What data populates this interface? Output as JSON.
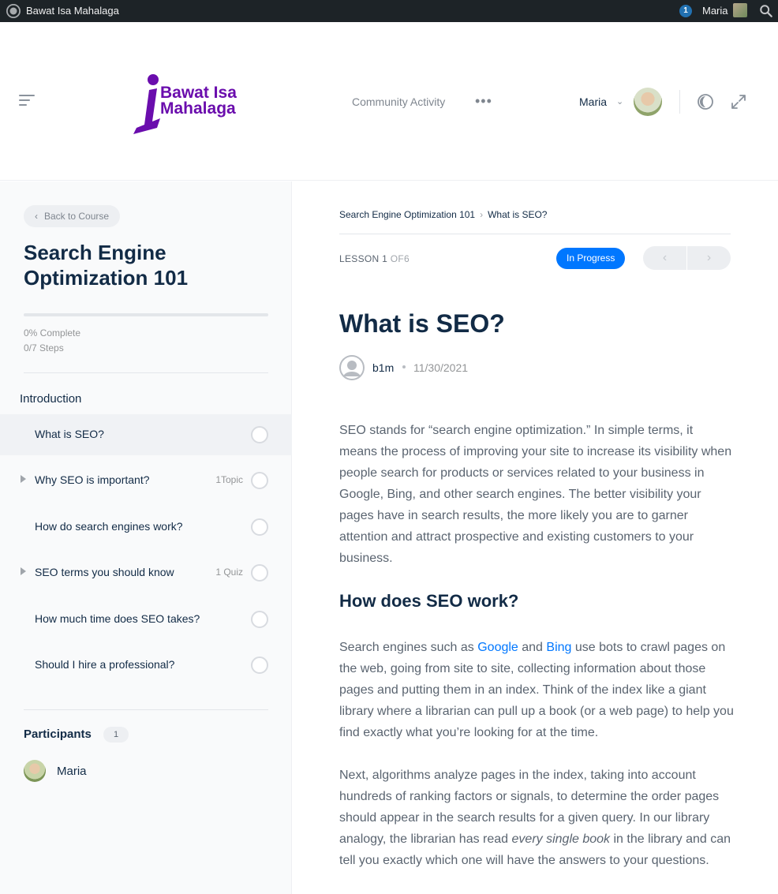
{
  "admin_bar": {
    "site_name": "Bawat Isa Mahalaga",
    "notification_count": "1",
    "user": "Maria"
  },
  "header": {
    "logo_line1": "Bawat Isa",
    "logo_line2": "Mahalaga",
    "nav_community": "Community Activity",
    "nav_more": "•••",
    "user_name": "Maria",
    "user_chevron": "⌄"
  },
  "sidebar": {
    "back_label": "Back to Course",
    "course_title": "Search Engine Optimization 101",
    "progress_fraction": 0,
    "percent_complete": "0% Complete",
    "steps": "0/7 Steps",
    "section": "Introduction",
    "lessons": [
      {
        "label": "What is SEO?",
        "meta": "",
        "expandable": false,
        "active": true
      },
      {
        "label": "Why SEO is important?",
        "meta": "1Topic",
        "expandable": true,
        "active": false
      },
      {
        "label": "How do search engines work?",
        "meta": "",
        "expandable": false,
        "active": false
      },
      {
        "label": "SEO terms you should know",
        "meta": "1 Quiz",
        "expandable": true,
        "active": false
      },
      {
        "label": "How much time does SEO takes?",
        "meta": "",
        "expandable": false,
        "active": false
      },
      {
        "label": "Should I hire a professional?",
        "meta": "",
        "expandable": false,
        "active": false
      }
    ],
    "participants_label": "Participants",
    "participants_count": "1",
    "participant_name": "Maria"
  },
  "main": {
    "breadcrumb_course": "Search Engine Optimization 101",
    "breadcrumb_sep": "›",
    "breadcrumb_lesson": "What is SEO?",
    "lesson_label": "LESSON 1",
    "lesson_of": "OF6",
    "status": "In Progress",
    "prev": "‹",
    "next": "›",
    "title": "What is SEO?",
    "author": "b1m",
    "date": "11/30/2021",
    "para1": "SEO stands for “search engine optimization.” In simple terms, it means the process of improving your site to increase its visibility when people search for products or services related to your business in Google, Bing, and other search engines. The better visibility your pages have in search results, the more likely you are to garner attention and attract prospective and existing customers to your business.",
    "heading2": "How does SEO work?",
    "para2_a": "Search engines such as ",
    "para2_link1": "Google",
    "para2_b": " and ",
    "para2_link2": "Bing",
    "para2_c": " use bots to crawl pages on the web, going from site to site, collecting information about those pages and putting them in an index. Think of the index like a giant library where a librarian can pull up a book (or a web page) to help you find exactly what you’re looking for at the time.",
    "para3_a": "Next, algorithms analyze pages in the index, taking into account hundreds of ranking factors or signals, to determine the order pages should appear in the search results for a given query. In our library analogy, the librarian has read ",
    "para3_em": "every single book",
    "para3_b": " in the library and can tell you exactly which one will have the answers to your questions."
  },
  "colors": {
    "accent": "#0077ff",
    "logo": "#6a0dad",
    "admin_bar": "#1d2327"
  }
}
